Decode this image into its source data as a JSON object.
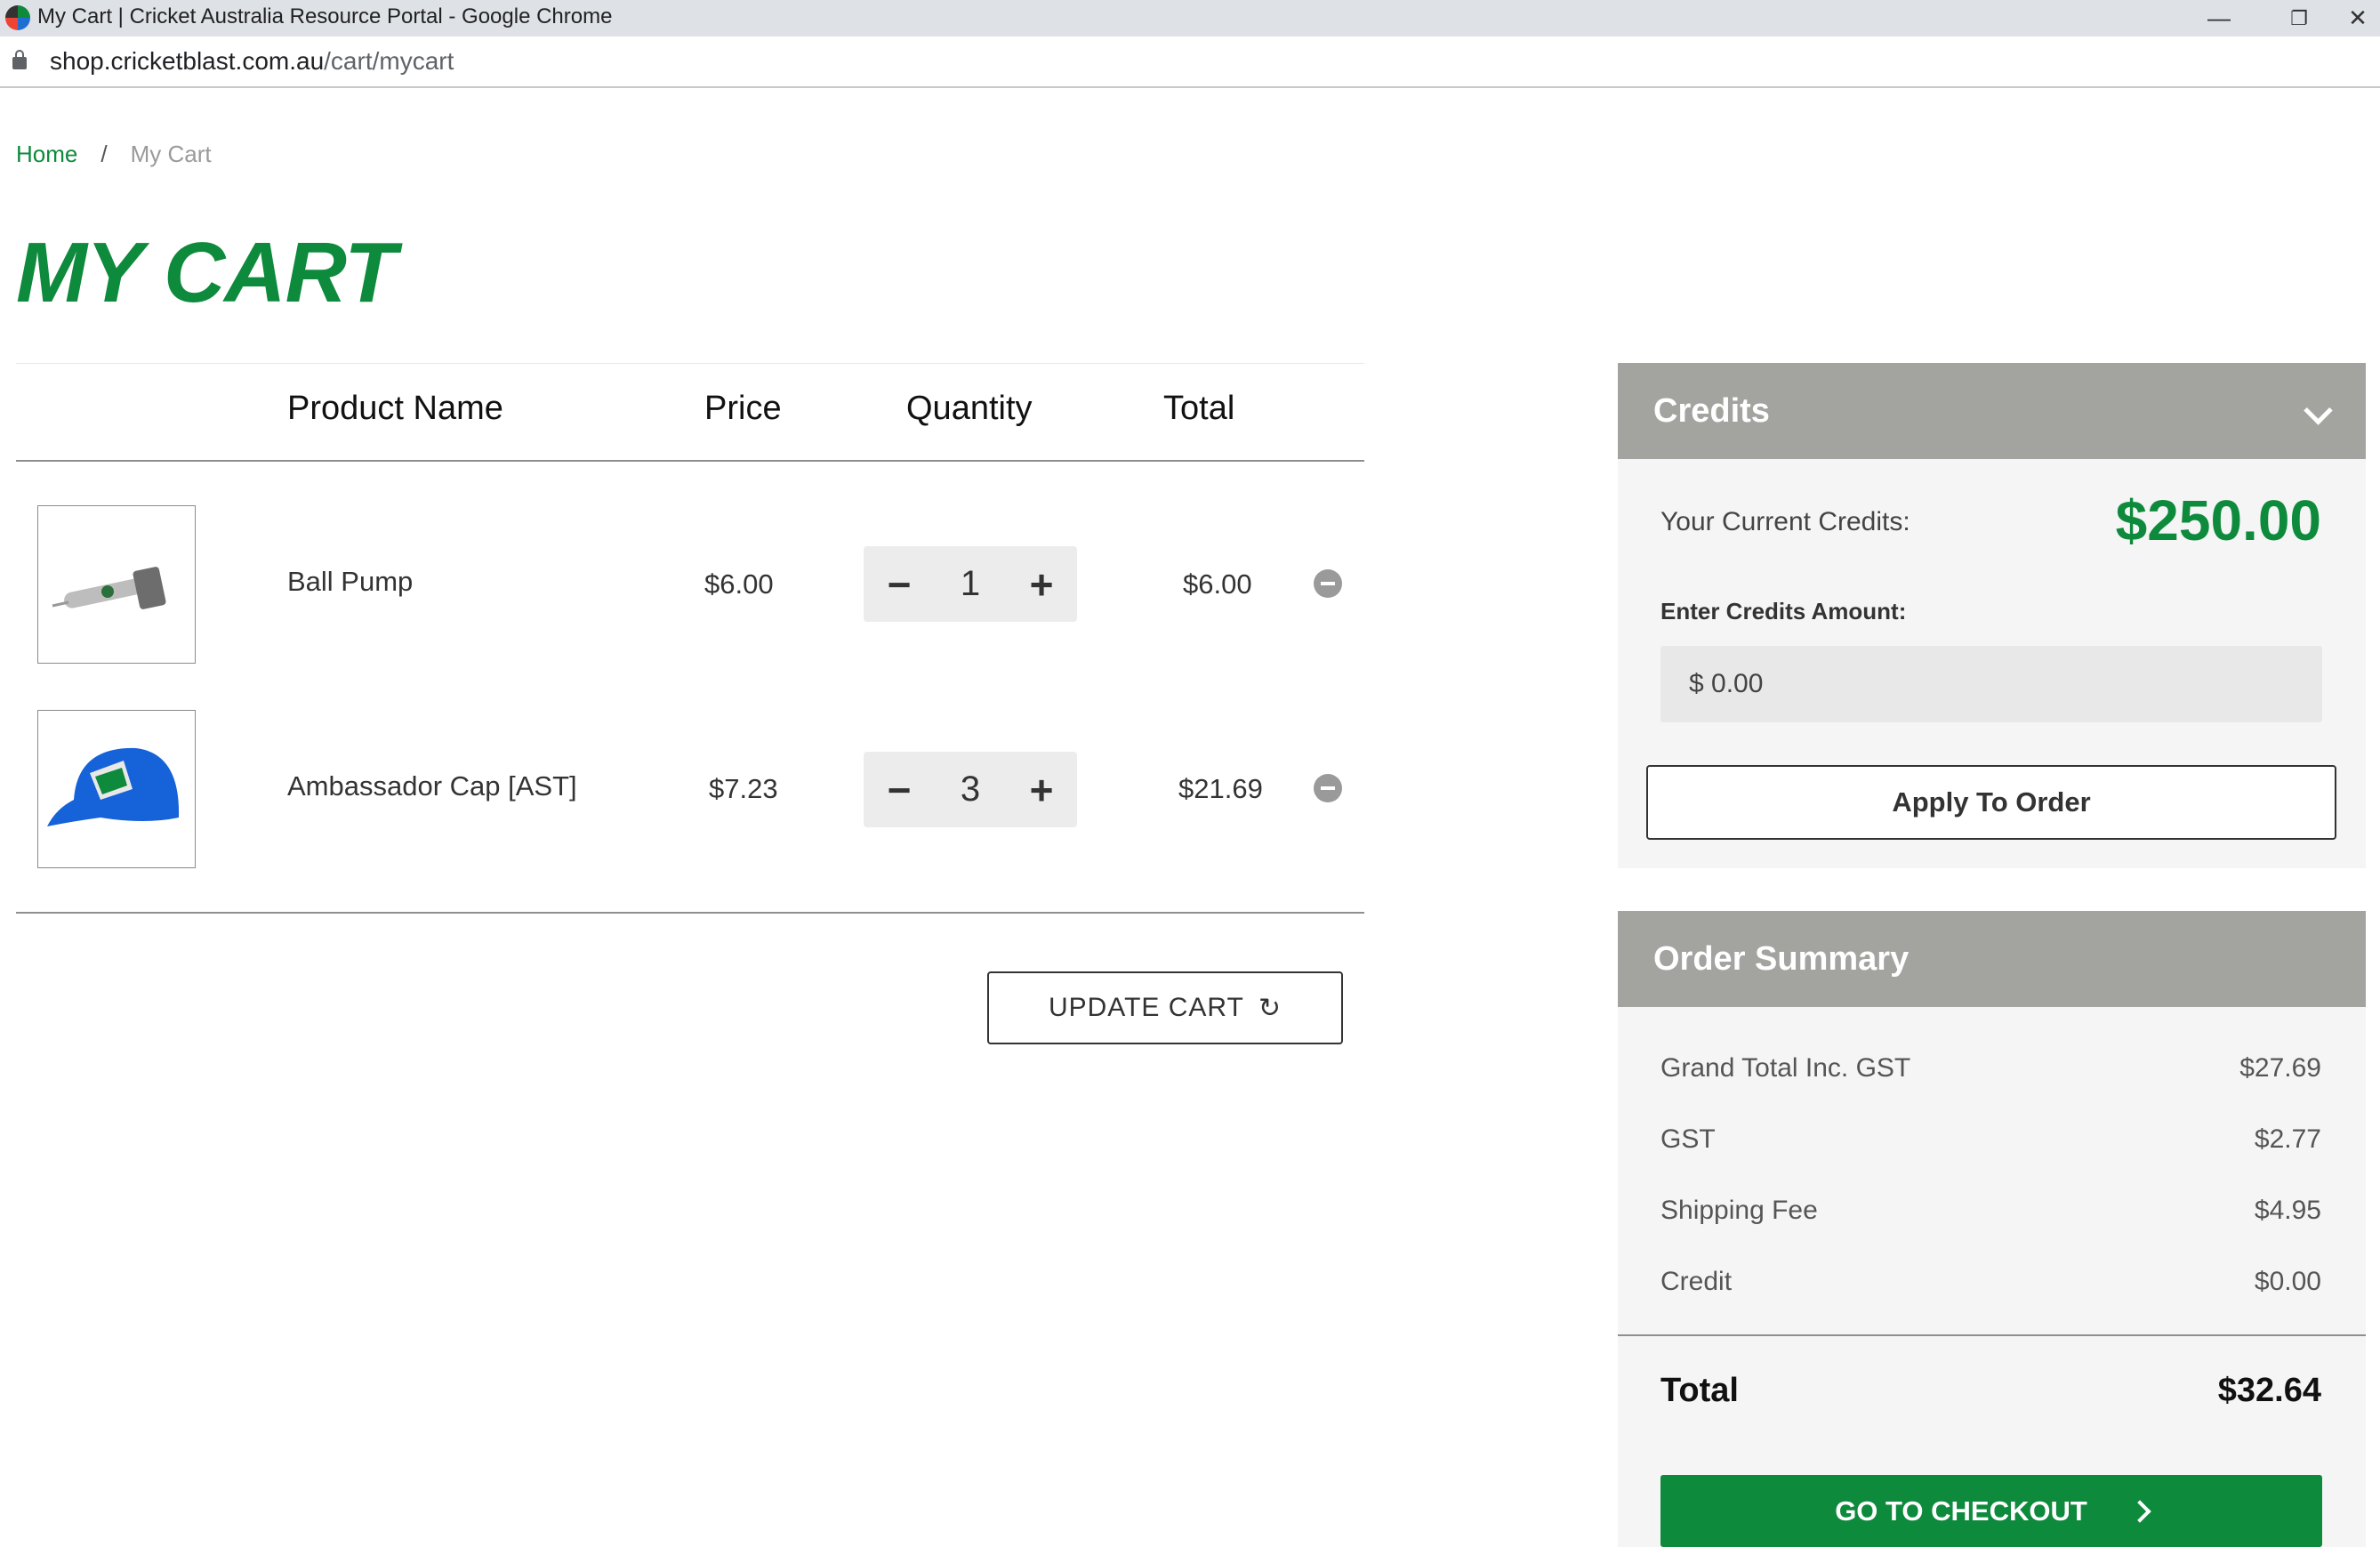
{
  "browser": {
    "window_title": "My Cart | Cricket Australia Resource Portal - Google Chrome",
    "url_domain": "shop.cricketblast.com.au",
    "url_path": "/cart/mycart",
    "minimize": "—",
    "restore": "❐",
    "close": "✕"
  },
  "breadcrumb": {
    "home": "Home",
    "separator": "/",
    "current": "My Cart"
  },
  "page_title": "MY CART",
  "cart": {
    "headers": {
      "product": "Product Name",
      "price": "Price",
      "quantity": "Quantity",
      "total": "Total"
    },
    "items": [
      {
        "name": "Ball Pump",
        "price": "$6.00",
        "quantity": "1",
        "total": "$6.00",
        "image_icon": "ball-pump-image"
      },
      {
        "name": "Ambassador Cap [AST]",
        "price": "$7.23",
        "quantity": "3",
        "total": "$21.69",
        "image_icon": "blue-cap-image"
      }
    ],
    "minus": "−",
    "plus": "+",
    "update_label": "UPDATE CART",
    "refresh_icon": "↻"
  },
  "credits": {
    "title": "Credits",
    "current_label": "Your Current Credits:",
    "current_value": "$250.00",
    "amount_label": "Enter Credits Amount:",
    "amount_value": "$ 0.00",
    "apply_label": "Apply To Order"
  },
  "summary": {
    "title": "Order Summary",
    "rows": [
      {
        "label": "Grand Total Inc. GST",
        "value": "$27.69"
      },
      {
        "label": "GST",
        "value": "$2.77"
      },
      {
        "label": "Shipping Fee",
        "value": "$4.95"
      },
      {
        "label": "Credit",
        "value": "$0.00"
      }
    ],
    "total_label": "Total",
    "total_value": "$32.64",
    "checkout_label": "GO TO CHECKOUT"
  },
  "colors": {
    "brand_green": "#0e8a3c",
    "panel_header": "#a3a3a0",
    "panel_bg": "#f5f5f5"
  }
}
